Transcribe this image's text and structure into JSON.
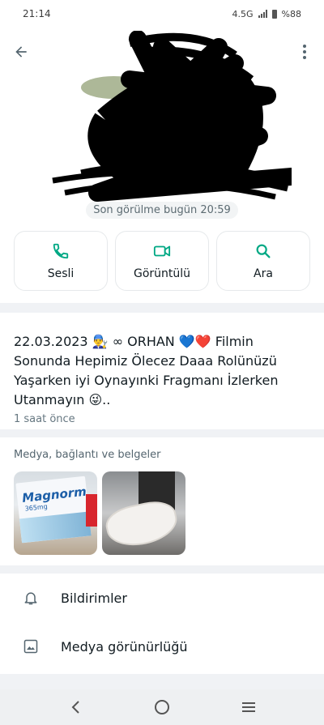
{
  "status_bar": {
    "time": "21:14",
    "network": "4.5G",
    "battery": "%88"
  },
  "contact": {
    "last_seen": "Son görülme bugün 20:59"
  },
  "actions": [
    {
      "label": "Sesli",
      "icon": "phone-icon"
    },
    {
      "label": "Görüntülü",
      "icon": "video-icon"
    },
    {
      "label": "Ara",
      "icon": "search-icon"
    }
  ],
  "about": {
    "text": "22.03.2023 👨‍🔧 ∞ ORHAN 💙❤️ Filmin Sonunda Hepimiz Ölecez Daaa Rolünüzü Yaşarken iyi Oynayınki Fragmanı İzlerken Utanmayın 😜..",
    "time": "1 saat önce"
  },
  "media": {
    "title": "Medya, bağlantı ve belgeler",
    "thumb1_brand": "Magnorm",
    "thumb1_sub": "365mg"
  },
  "settings": [
    {
      "label": "Bildirimler",
      "icon": "bell-icon"
    },
    {
      "label": "Medya görünürlüğü",
      "icon": "image-icon"
    }
  ],
  "colors": {
    "accent": "#00a884",
    "background": "#f0f2f5"
  }
}
